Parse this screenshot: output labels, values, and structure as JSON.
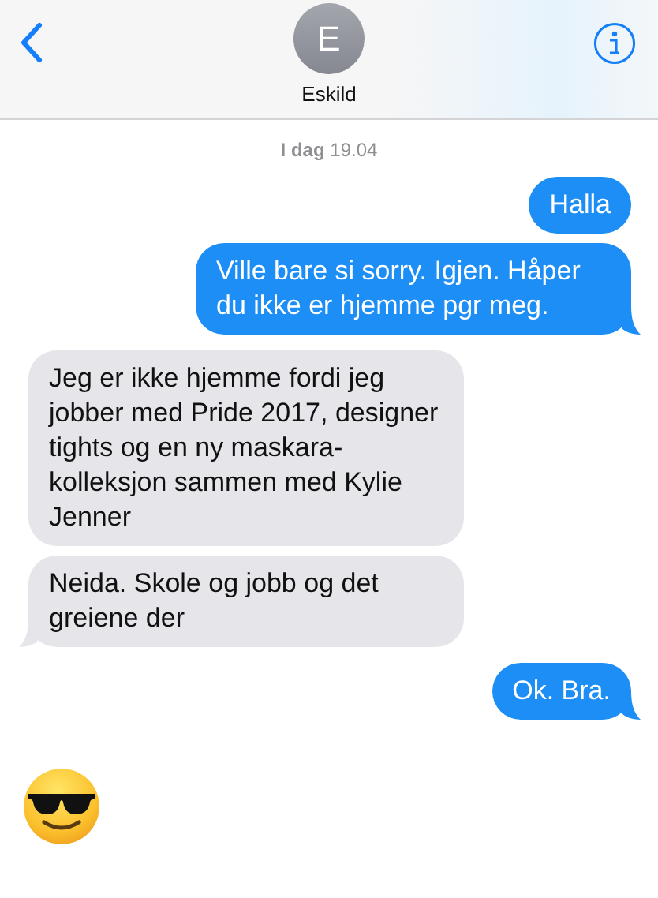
{
  "header": {
    "avatar_initial": "E",
    "contact_name": "Eskild"
  },
  "timestamp": "**I dag** 19.04",
  "messages": [
    {
      "kind": "sent",
      "text": "Halla",
      "tail": false
    },
    {
      "kind": "sent",
      "text": "Ville bare si sorry. Igjen. Håper du ikke er hjemme pgr meg.",
      "tail": true
    },
    {
      "kind": "received",
      "text": "Jeg er ikke hjemme fordi jeg jobber med Pride 2017, designer tights og en ny maskara-kolleksjon sammen med Kylie Jenner",
      "tail": false
    },
    {
      "kind": "received",
      "text": "Neida. Skole og jobb og det greiene der",
      "tail": true
    },
    {
      "kind": "sent",
      "text": "Ok. Bra.",
      "tail": true
    },
    {
      "kind": "emoji"
    }
  ]
}
